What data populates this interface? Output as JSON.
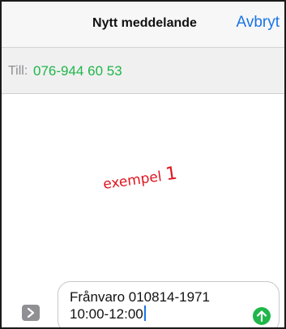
{
  "nav": {
    "title": "Nytt meddelande",
    "cancel_label": "Avbryt"
  },
  "recipient": {
    "label": "Till:",
    "number": "076-944 60 53"
  },
  "caption": {
    "text": "exempel",
    "number": "1"
  },
  "compose": {
    "line1": "Frånvaro 010814-1971",
    "line2": "10:00-12:00"
  },
  "icons": {
    "expand": "chevron-right-icon",
    "send": "arrow-up-icon"
  },
  "colors": {
    "accent_blue": "#1a73e8",
    "green": "#1fb64a",
    "caption_red": "#e0141e"
  }
}
